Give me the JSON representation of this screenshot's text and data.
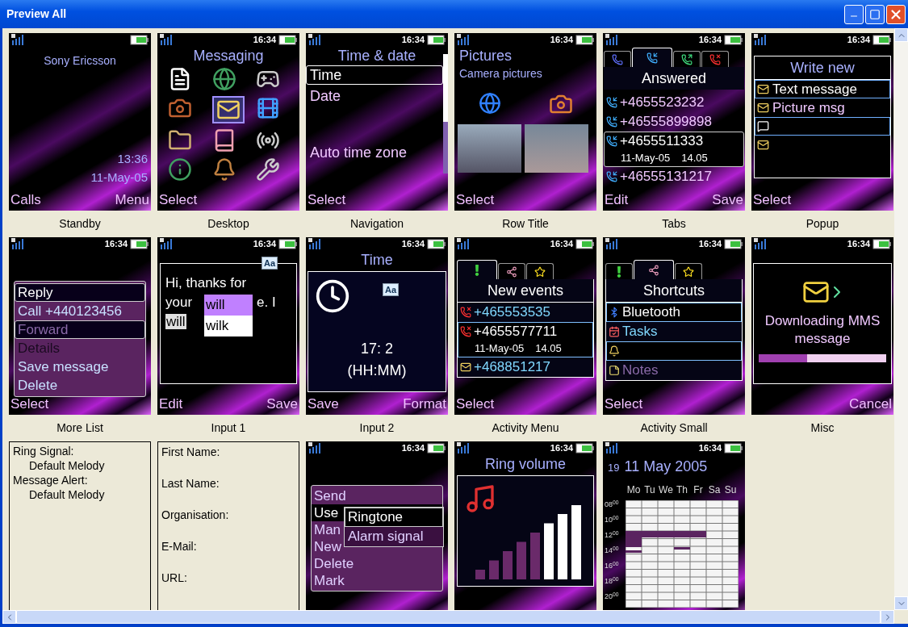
{
  "window": {
    "title": "Preview All"
  },
  "previews": [
    {
      "kind": "standby",
      "caption": "Standby",
      "operator": "Sony Ericsson",
      "clock": "13:36",
      "date": "11-May-05",
      "keys": {
        "left": "Calls",
        "right": "Menu"
      }
    },
    {
      "kind": "desktop",
      "caption": "Desktop",
      "time": "16:34",
      "title": "Messaging",
      "keys": {
        "left": "Select"
      }
    },
    {
      "kind": "list",
      "caption": "Navigation",
      "time": "16:34",
      "title": "Time & date",
      "items": [
        {
          "label": "Time",
          "selected": true
        },
        {
          "label": "Date",
          "selected": false
        },
        {
          "label": "Auto time zone",
          "selected": false
        }
      ],
      "keys": {
        "left": "Select"
      }
    },
    {
      "kind": "pictures",
      "caption": "Row Title",
      "time": "16:34",
      "title": "Pictures",
      "subtitle": "Camera pictures",
      "keys": {
        "left": "Select"
      }
    },
    {
      "kind": "tabs",
      "caption": "Tabs",
      "time": "16:34",
      "tabs": [
        {
          "kind": "calls",
          "selected": false
        },
        {
          "kind": "answered",
          "selected": true
        },
        {
          "kind": "dialled",
          "selected": false
        },
        {
          "kind": "missed",
          "selected": false
        }
      ],
      "heading": "Answered",
      "entries": [
        {
          "kind": "answered",
          "label": "+4655523232",
          "selected": false
        },
        {
          "kind": "answered",
          "label": "+46555899898",
          "selected": false
        },
        {
          "kind": "answered",
          "label": "+4655511333",
          "date": "11-May-05",
          "clock": "14.05",
          "selected": true
        },
        {
          "kind": "answered",
          "label": "+46555131217",
          "selected": false
        }
      ],
      "keys": {
        "left": "Edit",
        "right": "Save"
      }
    },
    {
      "kind": "popup",
      "caption": "Popup",
      "time": "16:34",
      "heading": "Write new",
      "items": [
        {
          "kind": "text",
          "label": "Text message",
          "selected": true
        },
        {
          "kind": "picture",
          "label": "Picture msg",
          "selected": false
        },
        {
          "kind": "chat",
          "selected": true
        },
        {
          "kind": "email",
          "selected": false
        }
      ],
      "keys": {
        "left": "Select"
      }
    },
    {
      "kind": "menu",
      "caption": "More List",
      "time": "16:34",
      "items": [
        {
          "label": "Reply",
          "selected": true,
          "dimmed": false
        },
        {
          "label": "Call +440123456",
          "selected": false,
          "dimmed": false
        },
        {
          "label": "Forward",
          "selected": true,
          "dimmed": true
        },
        {
          "label": "Details",
          "selected": false,
          "dimmed": true
        },
        {
          "label": "Save message",
          "selected": false,
          "dimmed": false
        },
        {
          "label": "Delete",
          "selected": false,
          "dimmed": false
        }
      ],
      "keys": {
        "left": "Select"
      }
    },
    {
      "kind": "input",
      "caption": "Input 1",
      "time": "16:34",
      "badge": "Aa",
      "line": "Hi, thanks for",
      "before": "your",
      "after": "e. I",
      "word": "will",
      "suggestions": [
        {
          "label": "will",
          "selected": true
        },
        {
          "label": "wilk",
          "selected": false
        }
      ],
      "keys": {
        "left": "Edit",
        "right": "Save"
      }
    },
    {
      "kind": "timeinput",
      "caption": "Input 2",
      "time": "16:34",
      "title": "Time",
      "badge": "Aa",
      "value": "17: 2",
      "format": "(HH:MM)",
      "keys": {
        "left": "Save",
        "right": "Format"
      }
    },
    {
      "kind": "activity",
      "caption": "Activity Menu",
      "time": "16:34",
      "tabs": [
        {
          "kind": "events",
          "selected": true
        },
        {
          "kind": "shortcuts",
          "selected": false
        },
        {
          "kind": "favourites",
          "selected": false
        }
      ],
      "heading": "New events",
      "entries": [
        {
          "kind": "missed",
          "label": "+465553535",
          "selected": false
        },
        {
          "kind": "missed",
          "label": "+4655577711",
          "date": "11-May-05",
          "clock": "14.05",
          "selected": true
        },
        {
          "kind": "message",
          "label": "+468851217",
          "selected": false
        }
      ],
      "keys": {
        "left": "Select"
      }
    },
    {
      "kind": "activity",
      "caption": "Activity Small",
      "time": "16:34",
      "tabs": [
        {
          "kind": "events",
          "selected": false
        },
        {
          "kind": "shortcuts",
          "selected": true
        },
        {
          "kind": "favourites",
          "selected": false
        }
      ],
      "heading": "Shortcuts",
      "entries": [
        {
          "kind": "bluetooth",
          "label": "Bluetooth",
          "selected": true,
          "dimmed": false
        },
        {
          "kind": "tasks",
          "label": "Tasks",
          "selected": false,
          "dimmed": false
        },
        {
          "kind": "alarm",
          "selected": true,
          "dimmed": false
        },
        {
          "kind": "notes",
          "label": "Notes",
          "selected": false,
          "dimmed": true
        }
      ],
      "keys": {
        "left": "Select"
      }
    },
    {
      "kind": "misc",
      "caption": "Misc",
      "time": "16:34",
      "message": "Downloading MMS message",
      "level": 0.38,
      "keys": {
        "right": "Cancel"
      }
    },
    {
      "kind": "tree",
      "items": [
        {
          "label": "Ring Signal:",
          "children": [
            {
              "label": "Default Melody"
            }
          ]
        },
        {
          "label": "Message Alert:",
          "children": [
            {
              "label": "Default Melody"
            }
          ]
        }
      ]
    },
    {
      "kind": "fields",
      "fields": [
        "First Name:",
        "Last Name:",
        "Organisation:",
        "E-Mail:",
        "URL:"
      ]
    },
    {
      "kind": "popmenu",
      "time": "16:34",
      "items": [
        {
          "label": "Send",
          "selected": false
        },
        {
          "label": "Use",
          "selected": true
        },
        {
          "label": "Man",
          "selected": false
        },
        {
          "label": "New",
          "selected": false
        },
        {
          "label": "Delete",
          "selected": false
        },
        {
          "label": "Mark",
          "selected": false
        }
      ],
      "submenu": [
        {
          "label": "Ringtone",
          "selected": true
        },
        {
          "label": "Alarm signal",
          "selected": false
        }
      ]
    },
    {
      "kind": "volume",
      "time": "16:34",
      "title": "Ring volume"
    },
    {
      "kind": "calendar",
      "time": "16:34",
      "week": "19",
      "date": "11 May 2005",
      "days": [
        "Mo",
        "Tu",
        "We",
        "Th",
        "Fr",
        "Sa",
        "Su"
      ],
      "hours": [
        "08$^{00}$",
        "10$^{00}$",
        "12$^{00}$",
        "14$^{00}$",
        "16$^{00}$",
        "18$^{00}$",
        "20$^{00}$"
      ]
    }
  ]
}
